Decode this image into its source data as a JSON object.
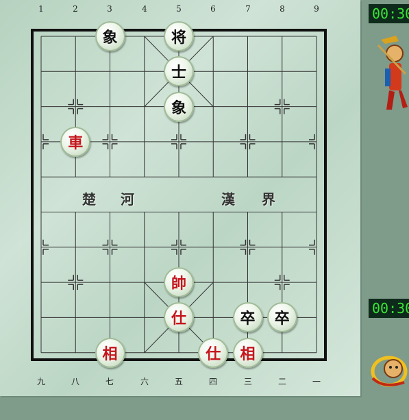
{
  "board": {
    "top_numbers": [
      "1",
      "2",
      "3",
      "4",
      "5",
      "6",
      "7",
      "8",
      "9"
    ],
    "bottom_numbers": [
      "九",
      "八",
      "七",
      "六",
      "五",
      "四",
      "三",
      "二",
      "一"
    ],
    "river_left": [
      "楚",
      "河"
    ],
    "river_right": [
      "漢",
      "界"
    ]
  },
  "pieces": [
    {
      "char": "象",
      "side": "black",
      "col": 3,
      "row": 0
    },
    {
      "char": "将",
      "side": "black",
      "col": 5,
      "row": 0
    },
    {
      "char": "士",
      "side": "black",
      "col": 5,
      "row": 1
    },
    {
      "char": "象",
      "side": "black",
      "col": 5,
      "row": 2
    },
    {
      "char": "車",
      "side": "red",
      "col": 2,
      "row": 3
    },
    {
      "char": "帥",
      "side": "red",
      "col": 5,
      "row": 7
    },
    {
      "char": "仕",
      "side": "red",
      "col": 5,
      "row": 8
    },
    {
      "char": "卒",
      "side": "black",
      "col": 7,
      "row": 8
    },
    {
      "char": "卒",
      "side": "black",
      "col": 8,
      "row": 8
    },
    {
      "char": "相",
      "side": "red",
      "col": 3,
      "row": 9
    },
    {
      "char": "仕",
      "side": "red",
      "col": 6,
      "row": 9
    },
    {
      "char": "相",
      "side": "red",
      "col": 7,
      "row": 9
    }
  ],
  "players": {
    "top": {
      "timer": "00:30"
    },
    "bottom": {
      "timer": "00:30"
    }
  },
  "colors": {
    "red_piece": "#c4161c",
    "black_piece": "#111111",
    "timer_text": "#39e635"
  }
}
